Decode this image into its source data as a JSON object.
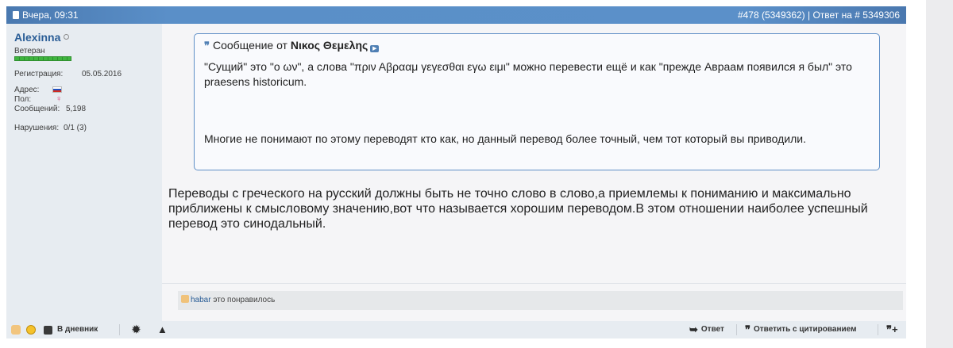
{
  "header": {
    "date": "Вчера, 09:31",
    "post_ref": "#478 (5349362) | Ответ на # 5349306"
  },
  "author": {
    "name": "Alexinna",
    "rank": "Ветеран",
    "registration_label": "Регистрация:",
    "registration_value": "05.05.2016",
    "address_label": "Адрес:",
    "gender_label": "Пол:",
    "gender_value": "♀",
    "messages_label": "Сообщений:",
    "messages_value": "5,198",
    "violations_label": "Нарушения:",
    "violations_value": "0/1 (3)"
  },
  "quote": {
    "icon": "quote-icon",
    "prefix": "Сообщение от",
    "author": "Νικος Θεμελης",
    "goto_icon": "goto-post-icon",
    "paragraph1": "\"Сущий\" это \"ο ων\", а слова \"πριν Αβρααμ γεγεσθαι εγω ειμι\" можно перевести ещё и как \"прежде Авраам появился я был\" это praesens historicum.",
    "paragraph2": "Многие не понимают по этому переводят кто как, но данный перевод более точный, чем тот который вы приводили."
  },
  "message": "Переводы с греческого на русский должны быть не точно слово в слово,а приемлемы к пониманию и максимально приближены к смысловому значению,вот что называется хорошим переводом.В этом отношении наиболее успешный перевод это синодальный.",
  "likes": {
    "user": "habar",
    "text": "это понравилось"
  },
  "toolbar": {
    "diary_label": "В дневник",
    "reply_label": "Ответ",
    "quote_reply_label": "Ответить с цитированием",
    "reply_glyph": "➥",
    "multiquote_glyph": "❞+"
  },
  "colors": {
    "header_blue": "#5b90c9",
    "username": "#2a5d96",
    "quote_border": "#5f8fc6",
    "sidebar_bg": "#e7ecf1"
  }
}
